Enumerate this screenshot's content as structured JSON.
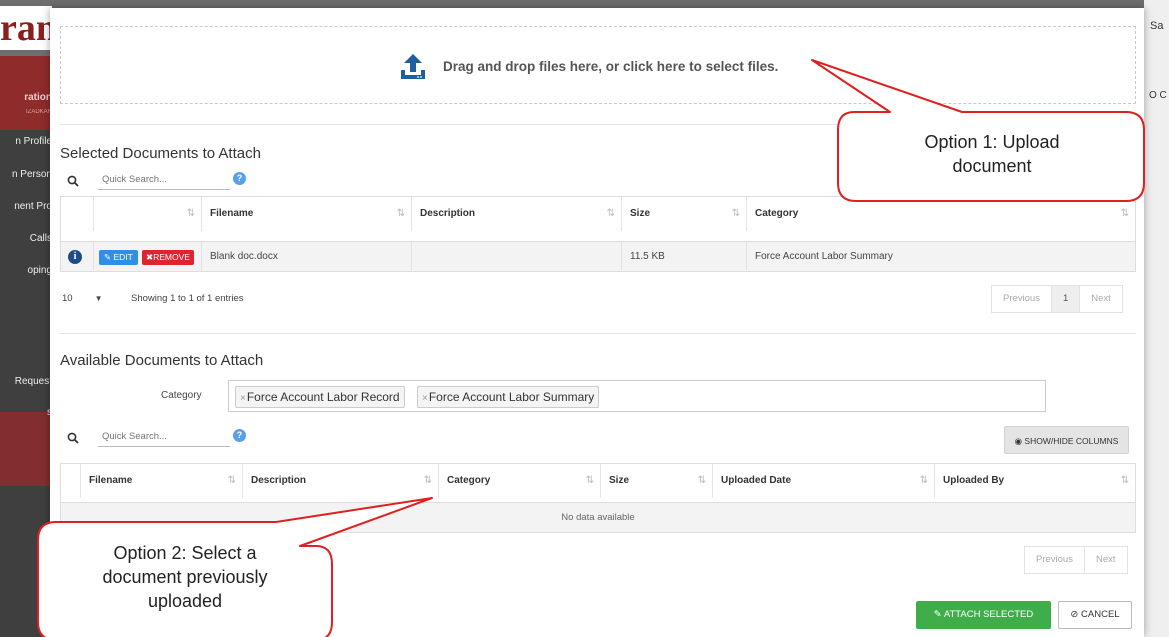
{
  "background": {
    "logo_fragment": "ran",
    "sidebar_items": [
      "ration",
      "IZADKAN",
      "n Profile",
      "n Person",
      "nent Pro",
      "Calls",
      "oping",
      "Request",
      "s",
      "e"
    ],
    "right_user_fragment": "Sa",
    "right_fragment": "O C"
  },
  "dropzone": {
    "icon": "upload-icon",
    "text": "Drag and drop files here, or click here to select files."
  },
  "selected": {
    "title": "Selected Documents to Attach",
    "search_placeholder": "Quick Search...",
    "help": "?",
    "columns": [
      "Filename",
      "Description",
      "Size",
      "Category"
    ],
    "rows": [
      {
        "info": "i",
        "edit": "EDIT",
        "remove": "REMOVE",
        "filename": "Blank doc.docx",
        "description": "",
        "size": "11.5 KB",
        "category": "Force Account Labor Summary"
      }
    ],
    "page_length": "10",
    "info": "Showing 1 to 1 of 1 entries",
    "pager": {
      "previous": "Previous",
      "page": "1",
      "next": "Next"
    }
  },
  "available": {
    "title": "Available Documents to Attach",
    "category_label": "Category",
    "category_chips": [
      "Force Account Labor Record",
      "Force Account Labor Summary"
    ],
    "search_placeholder": "Quick Search...",
    "help": "?",
    "show_hide_columns": "SHOW/HIDE COLUMNS",
    "columns": [
      "Filename",
      "Description",
      "Category",
      "Size",
      "Uploaded Date",
      "Uploaded By"
    ],
    "empty_text": "No data available",
    "pager": {
      "previous": "Previous",
      "next": "Next"
    }
  },
  "footer": {
    "attach": "ATTACH SELECTED",
    "cancel": "CANCEL"
  },
  "callouts": {
    "option1": "Option 1: Upload document",
    "option1_lines": [
      "Option 1: Upload",
      "document"
    ],
    "option2_lines": [
      "Option 2: Select a",
      "document previously",
      "uploaded"
    ],
    "color": "#e02020"
  },
  "colors": {
    "accent_blue": "#2f8fe8",
    "remove_red": "#e0242f",
    "attach_green": "#3fae4a",
    "upload_icon": "#1f5f9e"
  }
}
